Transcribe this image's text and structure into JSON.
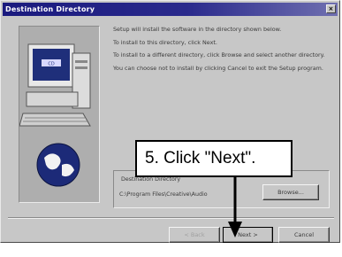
{
  "window": {
    "title": "Destination Directory",
    "close_glyph": "×"
  },
  "body_text": [
    "Setup will install the software in the directory shown below.",
    "To install to this directory, click Next.",
    "To install to a different directory, click Browse and select another directory.",
    "You can choose not to install by clicking Cancel to exit the Setup program."
  ],
  "destination": {
    "group_label": "Destination Directory",
    "path": "C:\\Program Files\\Creative\\Audio",
    "browse_label": "Browse..."
  },
  "buttons": {
    "back_label": "< Back",
    "next_label": "Next >",
    "cancel_label": "Cancel"
  },
  "callout": {
    "text": "5. Click \"Next\"."
  },
  "colors": {
    "titlebar": "#1a1a7e",
    "dialog_face": "#c7c7c7"
  },
  "icons": [
    "computer-icon",
    "globe-icon",
    "close-icon",
    "arrow-down-icon"
  ]
}
